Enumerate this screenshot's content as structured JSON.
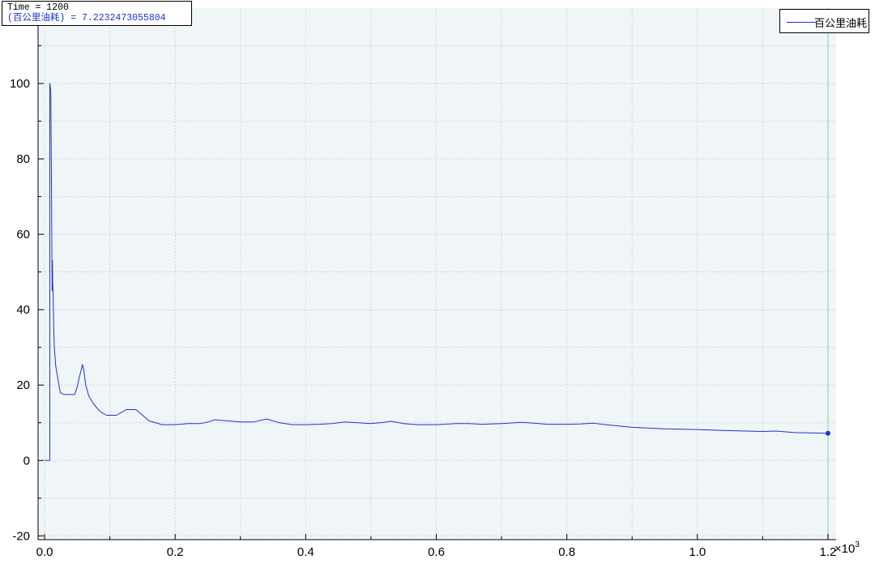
{
  "cursor": {
    "time_text": "Time = 1200",
    "value_text": "(百公里油耗) = 7.2232473055804"
  },
  "colors": {
    "series": "#1f32d6",
    "plot_bg": "#f0f5f8",
    "grid": "#c8d8e4",
    "cursor_line": "#a8dcd0"
  },
  "chart_data": {
    "type": "line",
    "xlim": [
      -0.01,
      1.2125
    ],
    "ylim": [
      -21,
      120
    ],
    "x_ticks": [
      0,
      0.2,
      0.4,
      0.6,
      0.8,
      1.0,
      1.2
    ],
    "x_tick_labels": [
      "0.0",
      "0.2",
      "0.4",
      "0.6",
      "0.8",
      "1.0",
      "1.2"
    ],
    "x_multiplier": "×10",
    "x_multiplier_exp": "3",
    "y_ticks": [
      -20,
      0,
      20,
      40,
      60,
      80,
      100
    ],
    "y_tick_labels": [
      "-20",
      "0",
      "20",
      "40",
      "60",
      "80",
      "100"
    ],
    "grid": true,
    "legend_position": "top-right",
    "cursor_x": 1.2,
    "series": [
      {
        "name": "百公里油耗",
        "x": [
          0,
          0.008,
          0.008,
          0.0095,
          0.0105,
          0.011,
          0.0115,
          0.012,
          0.0125,
          0.013,
          0.014,
          0.015,
          0.017,
          0.02,
          0.024,
          0.03,
          0.04,
          0.046,
          0.05,
          0.053,
          0.056,
          0.058,
          0.06,
          0.063,
          0.068,
          0.075,
          0.085,
          0.095,
          0.11,
          0.125,
          0.14,
          0.15,
          0.16,
          0.18,
          0.2,
          0.22,
          0.24,
          0.25,
          0.26,
          0.28,
          0.3,
          0.32,
          0.34,
          0.36,
          0.38,
          0.4,
          0.42,
          0.44,
          0.46,
          0.48,
          0.5,
          0.52,
          0.53,
          0.55,
          0.57,
          0.6,
          0.63,
          0.65,
          0.67,
          0.7,
          0.73,
          0.75,
          0.77,
          0.8,
          0.82,
          0.84,
          0.86,
          0.9,
          0.95,
          1.0,
          1.05,
          1.1,
          1.12,
          1.15,
          1.2
        ],
        "y": [
          0,
          0,
          100,
          98,
          75,
          60,
          45,
          53,
          47,
          45,
          35,
          30,
          25,
          22,
          18,
          17.5,
          17.5,
          17.5,
          19.5,
          22,
          24,
          25.5,
          24,
          20,
          17,
          15,
          13,
          12,
          12,
          13.5,
          13.5,
          12,
          10.5,
          9.5,
          9.5,
          9.8,
          9.8,
          10.2,
          10.8,
          10.5,
          10.2,
          10.2,
          11,
          10,
          9.5,
          9.5,
          9.6,
          9.8,
          10.2,
          10,
          9.8,
          10.1,
          10.4,
          9.8,
          9.5,
          9.5,
          9.8,
          9.8,
          9.6,
          9.8,
          10.1,
          9.9,
          9.6,
          9.6,
          9.7,
          9.9,
          9.5,
          8.8,
          8.4,
          8.2,
          7.9,
          7.7,
          7.8,
          7.4,
          7.22
        ]
      }
    ]
  }
}
